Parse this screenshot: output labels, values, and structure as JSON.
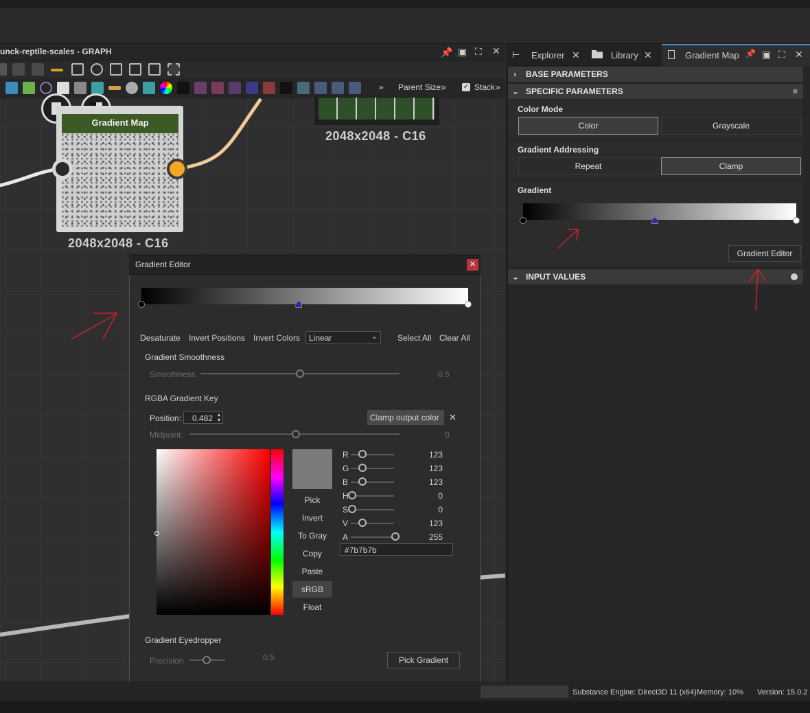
{
  "graph": {
    "title": "unck-reptile-scales - GRAPH",
    "node_title": "Gradient Map",
    "node_size": "2048x2048 - C16",
    "other_node_size": "2048x2048 - C16",
    "toolbar": {
      "parent_size_label": "Parent Size:",
      "stack_label": "Stack"
    }
  },
  "right_panel": {
    "tabs": [
      {
        "label": "Explorer"
      },
      {
        "label": "Library"
      },
      {
        "label": "Gradient Map"
      }
    ],
    "sections": {
      "base_parameters": "BASE PARAMETERS",
      "specific_parameters": "SPECIFIC PARAMETERS",
      "input_values": "INPUT VALUES"
    },
    "color_mode": {
      "label": "Color Mode",
      "options": [
        "Color",
        "Grayscale"
      ],
      "selected": "Color"
    },
    "gradient_addressing": {
      "label": "Gradient Addressing",
      "options": [
        "Repeat",
        "Clamp"
      ],
      "selected": "Clamp"
    },
    "gradient": {
      "label": "Gradient",
      "editor_button": "Gradient Editor",
      "stops": [
        0,
        0.482,
        1
      ]
    }
  },
  "dialog": {
    "title": "Gradient Editor",
    "actions": [
      "Desaturate",
      "Invert Positions",
      "Invert Colors"
    ],
    "interpolation": "Linear",
    "select_all": "Select All",
    "clear_all": "Clear All",
    "smoothness": {
      "heading": "Gradient Smoothness",
      "label": "Smoothness",
      "value": "0.5"
    },
    "key": {
      "heading": "RGBA Gradient Key",
      "position_label": "Position:",
      "position_value": "0.482",
      "clamp_label": "Clamp output color",
      "midpoint_label": "Midpoint:",
      "midpoint_value": "0"
    },
    "color_buttons": [
      "Pick",
      "Invert",
      "To Gray",
      "Copy",
      "Paste",
      "sRGB",
      "Float"
    ],
    "channels": [
      {
        "name": "R",
        "value": "123"
      },
      {
        "name": "G",
        "value": "123"
      },
      {
        "name": "B",
        "value": "123"
      },
      {
        "name": "H",
        "value": "0"
      },
      {
        "name": "S",
        "value": "0"
      },
      {
        "name": "V",
        "value": "123"
      },
      {
        "name": "A",
        "value": "255"
      }
    ],
    "hex": "#7b7b7b",
    "eyedropper": {
      "heading": "Gradient Eyedropper",
      "precision_label": "Precision",
      "precision_value": "0.5",
      "pick_button": "Pick Gradient"
    }
  },
  "status": {
    "engine": "Substance Engine: Direct3D 11 (x64)",
    "memory": "Memory: 10%",
    "version": "Version: 15.0.2"
  },
  "colors": {
    "node_header": "#3c5a24",
    "socket_output": "#f5a623",
    "annotation_arrow": "#d0202a"
  }
}
